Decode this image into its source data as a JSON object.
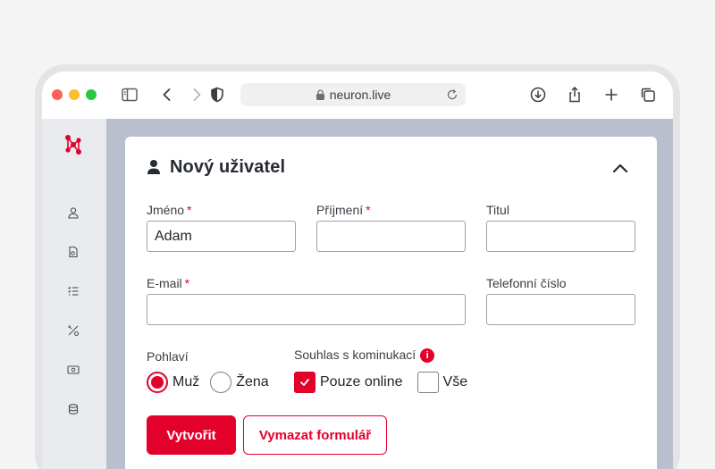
{
  "browser": {
    "url": "neuron.live"
  },
  "sidebar": {
    "items": [
      {
        "icon": "user-icon"
      },
      {
        "icon": "document-icon"
      },
      {
        "icon": "checklist-icon"
      },
      {
        "icon": "tools-icon"
      },
      {
        "icon": "money-icon"
      },
      {
        "icon": "coins-icon"
      }
    ]
  },
  "card": {
    "title": "Nový uživatel"
  },
  "form": {
    "first_name": {
      "label": "Jméno",
      "required": "*",
      "value": "Adam"
    },
    "last_name": {
      "label": "Příjmení",
      "required": "*",
      "value": ""
    },
    "title": {
      "label": "Titul",
      "value": ""
    },
    "email": {
      "label": "E-mail",
      "required": "*",
      "value": ""
    },
    "phone": {
      "label": "Telefonní číslo",
      "value": ""
    },
    "gender": {
      "label": "Pohlaví",
      "options": [
        {
          "label": "Muž",
          "selected": true
        },
        {
          "label": "Žena",
          "selected": false
        }
      ]
    },
    "consent": {
      "label": "Souhlas s kominukací",
      "info": "i",
      "options": [
        {
          "label": "Pouze online",
          "checked": true
        },
        {
          "label": "Vše",
          "checked": false
        }
      ]
    }
  },
  "actions": {
    "create_label": "Vytvořit",
    "clear_label": "Vymazat formulář"
  },
  "colors": {
    "accent": "#e3002b",
    "app_background": "#b9bfcd"
  }
}
